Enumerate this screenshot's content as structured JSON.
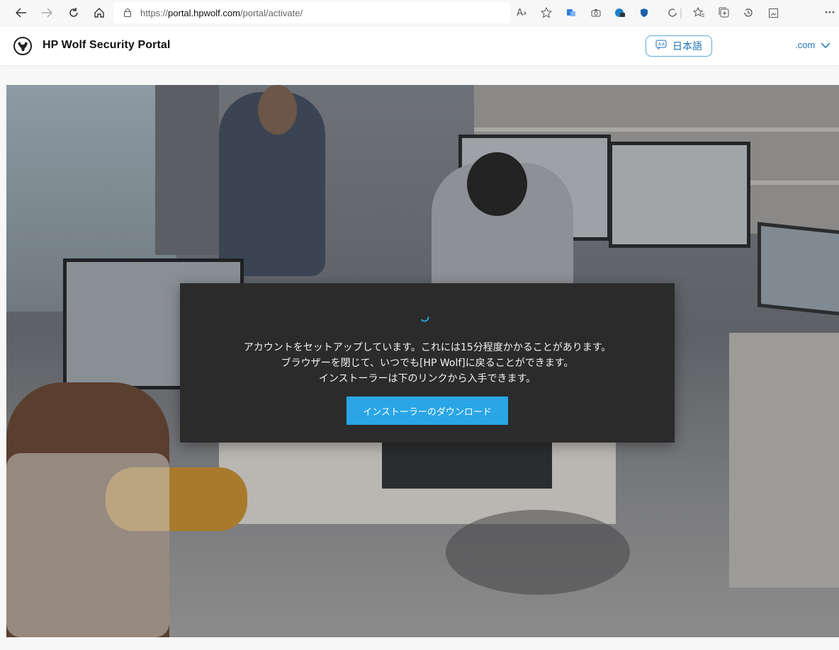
{
  "browser": {
    "url_prefix": "https://",
    "url_host": "portal.hpwolf.com",
    "url_path": "/portal/activate/",
    "more_label": "···"
  },
  "header": {
    "site_title": "HP Wolf Security Portal",
    "language_label": "日本語",
    "domain_label": ".com"
  },
  "modal": {
    "line1": "アカウントをセットアップしています。これには15分程度かかることがあります。",
    "line2": "ブラウザーを閉じて、いつでも[HP Wolf]に戻ることができます。",
    "line3": "インストーラーは下のリンクから入手できます。",
    "download_button": "インストーラーのダウンロード"
  },
  "colors": {
    "accent": "#2aa6e6",
    "link": "#1f73b7",
    "modal_bg": "#2b2b2b"
  }
}
